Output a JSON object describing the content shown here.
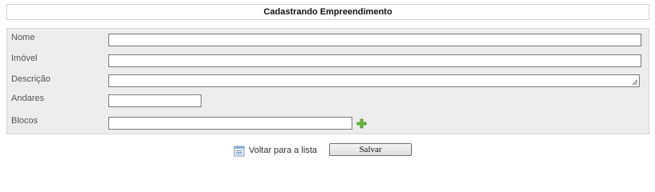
{
  "header": {
    "title": "Cadastrando Empreendimento"
  },
  "form": {
    "nome": {
      "label": "Nome",
      "value": ""
    },
    "imovel": {
      "label": "Imóvel",
      "value": ""
    },
    "descricao": {
      "label": "Descrição",
      "value": ""
    },
    "andares": {
      "label": "Andares",
      "value": ""
    },
    "blocos": {
      "label": "Blocos",
      "value": "",
      "add_icon": "plus-icon"
    }
  },
  "footer": {
    "back_label": "Voltar para a lista",
    "back_icon": "list-icon",
    "save_label": "Salvar"
  },
  "colors": {
    "panel_bg": "#ececec",
    "add_icon": "#5aa02c"
  }
}
